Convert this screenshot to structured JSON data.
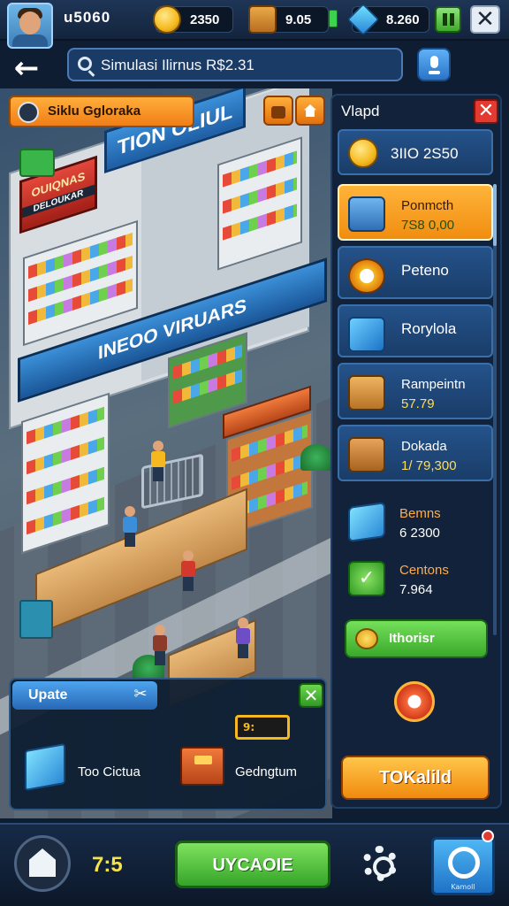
{
  "topbar": {
    "player_id": "u5060",
    "coins": "2350",
    "chests": "9.05",
    "gems": "8.260"
  },
  "search": {
    "value": "Simulasi Ilirnus R$2.31"
  },
  "scene": {
    "tag_label": "Siklu Ggloraka",
    "signs": {
      "title": "TION OLIUL",
      "red_top": "OUIQNAS",
      "red_sub": "DELOUKAR",
      "middle": "INEOO VIRUARS"
    }
  },
  "update_panel": {
    "title": "Upate",
    "badge": "9:",
    "items": [
      {
        "label": "Too Cictua",
        "icon": "cube-icon"
      },
      {
        "label": "Gedngtum",
        "icon": "box-icon"
      }
    ]
  },
  "side_panel": {
    "title": "Vlapd",
    "cards": [
      {
        "name": "3IIO 2S50",
        "value": "",
        "icon": "coin-icon",
        "selected": false
      },
      {
        "name": "Ponmcth",
        "value": "7S8 0,00",
        "icon": "device-icon",
        "selected": true
      },
      {
        "name": "Peteno",
        "value": "",
        "icon": "cog-icon",
        "selected": false
      },
      {
        "name": "Rorylola",
        "value": "",
        "icon": "cube-blue-icon",
        "selected": false
      },
      {
        "name": "Rampeintn",
        "value": "57.79",
        "icon": "crate-icon",
        "selected": false
      },
      {
        "name": "Dokada",
        "value": "1/ 79,300",
        "icon": "crate-stamp-icon",
        "selected": false
      }
    ],
    "plain_items": [
      {
        "name": "Bemns",
        "value": "6 2300",
        "icon": "cube-icon"
      },
      {
        "name": "Centons",
        "value": "7.964",
        "icon": "check-icon"
      }
    ],
    "green_button": "Ithorisr",
    "orange_button": "TOKalild"
  },
  "bottombar": {
    "timer": "7:5",
    "upgrade_button": "UYCAOIE",
    "profile_caption": "Kamoll"
  }
}
